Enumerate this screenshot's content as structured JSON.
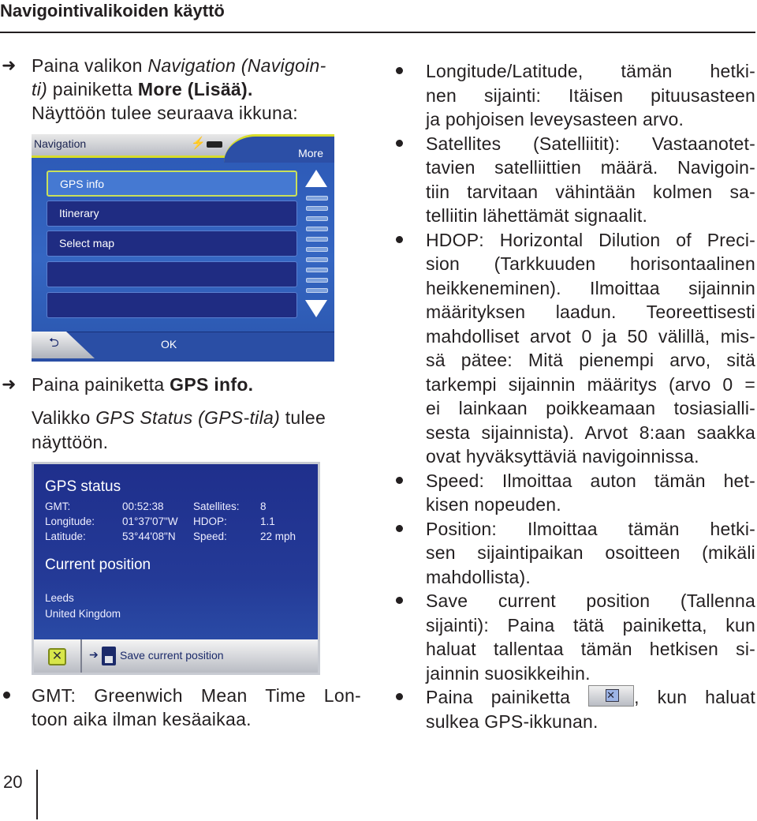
{
  "header": {
    "title": "Navigointivalikoiden käyttö"
  },
  "left": {
    "step1": {
      "a": "Paina valikon ",
      "b": "Navigation (Navigoin-",
      "c": "ti)",
      "d": " painiketta ",
      "e": "More (Lisää).",
      "f": "Näyttöön tulee seuraava ikkuna:"
    },
    "step2": {
      "a": "Paina painiketta ",
      "b": "GPS info.",
      "c": "Valikko ",
      "d": "GPS Status (GPS-tila)",
      "e": " tulee",
      "f": "näyttöön."
    },
    "gmt_bullet": [
      "GMT: Greenwich Mean Time Lon-",
      "toon aika ilman kesäaikaa."
    ]
  },
  "nav_screen": {
    "title": "Navigation",
    "more": "More",
    "items": [
      "GPS info",
      "Itinerary",
      "Select map",
      "",
      ""
    ],
    "selected": 0,
    "ok": "OK",
    "back_icon": "back-arrow-icon"
  },
  "gps_screen": {
    "title": "GPS status",
    "rows": [
      {
        "label": "GMT:",
        "value": "00:52:38",
        "label2": "Satellites:",
        "value2": "8"
      },
      {
        "label": "Longitude:",
        "value": "01°37'07\"W",
        "label2": "HDOP:",
        "value2": "1.1"
      },
      {
        "label": "Latitude:",
        "value": "53°44'08\"N",
        "label2": "Speed:",
        "value2": "22 mph"
      }
    ],
    "current_title": "Current position",
    "city": "Leeds",
    "country": "United Kingdom",
    "save_label": "Save current position"
  },
  "right": {
    "bullets": [
      [
        "Longitude/Latitude, tämän hetki-",
        "nen sijainti: Itäisen pituusasteen",
        "ja pohjoisen leveysasteen arvo."
      ],
      [
        "Satellites (Satelliitit): Vastaanotet-",
        "tavien satelliittien määrä. Navigoin-",
        "tiin tarvitaan vähintään kolmen sa-",
        "telliitin lähettämät signaalit."
      ],
      [
        "HDOP: Horizontal Dilution of Preci-",
        "sion (Tarkkuuden horisontaalinen",
        "heikkeneminen). Ilmoittaa sijainnin",
        "määrityksen laadun. Teoreettisesti",
        "mahdolliset arvot 0 ja 50 välillä, mis-",
        "sä pätee: Mitä pienempi arvo, sitä",
        "tarkempi sijainnin määritys (arvo 0 =",
        "ei lainkaan poikkeamaan tosiasialli-",
        "sesta sijainnista). Arvot 8:aan saakka",
        "ovat hyväksyttäviä navigoinnissa."
      ],
      [
        "Speed: Ilmoittaa auton tämän het-",
        "kisen nopeuden."
      ],
      [
        "Position: Ilmoittaa tämän hetki-",
        "sen sijaintipaikan osoitteen (mikäli",
        "mahdollista)."
      ],
      [
        "Save current position (Tallenna",
        "sijainti): Paina tätä painiketta, kun",
        "haluat tallentaa tämän hetkisen si-",
        "jainnin suosikkeihin."
      ]
    ],
    "close_bullet": {
      "before": "Paina painiketta",
      "after": ", kun haluat",
      "line2": "sulkea GPS-ikkunan."
    }
  },
  "page_number": "20"
}
